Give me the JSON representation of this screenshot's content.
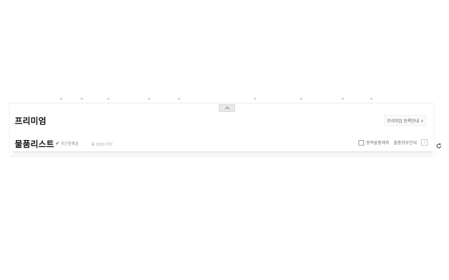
{
  "premium": {
    "title": "프리미엄",
    "guide_label": "프리미엄 등록안내",
    "guide_chevron": "›"
  },
  "list": {
    "title": "물품리스트",
    "recent_label": "최근등록순",
    "count_label": "총 1000 이상"
  },
  "controls": {
    "checkbox_label": "중복물품제외",
    "info_label": "물품정보안내",
    "small_button_label": "i",
    "collapse_icon": "chevron-up-icon",
    "refresh_icon": "refresh-icon"
  },
  "colors": {
    "accent": "#2f6fd6",
    "text": "#111111",
    "muted": "#777777"
  }
}
